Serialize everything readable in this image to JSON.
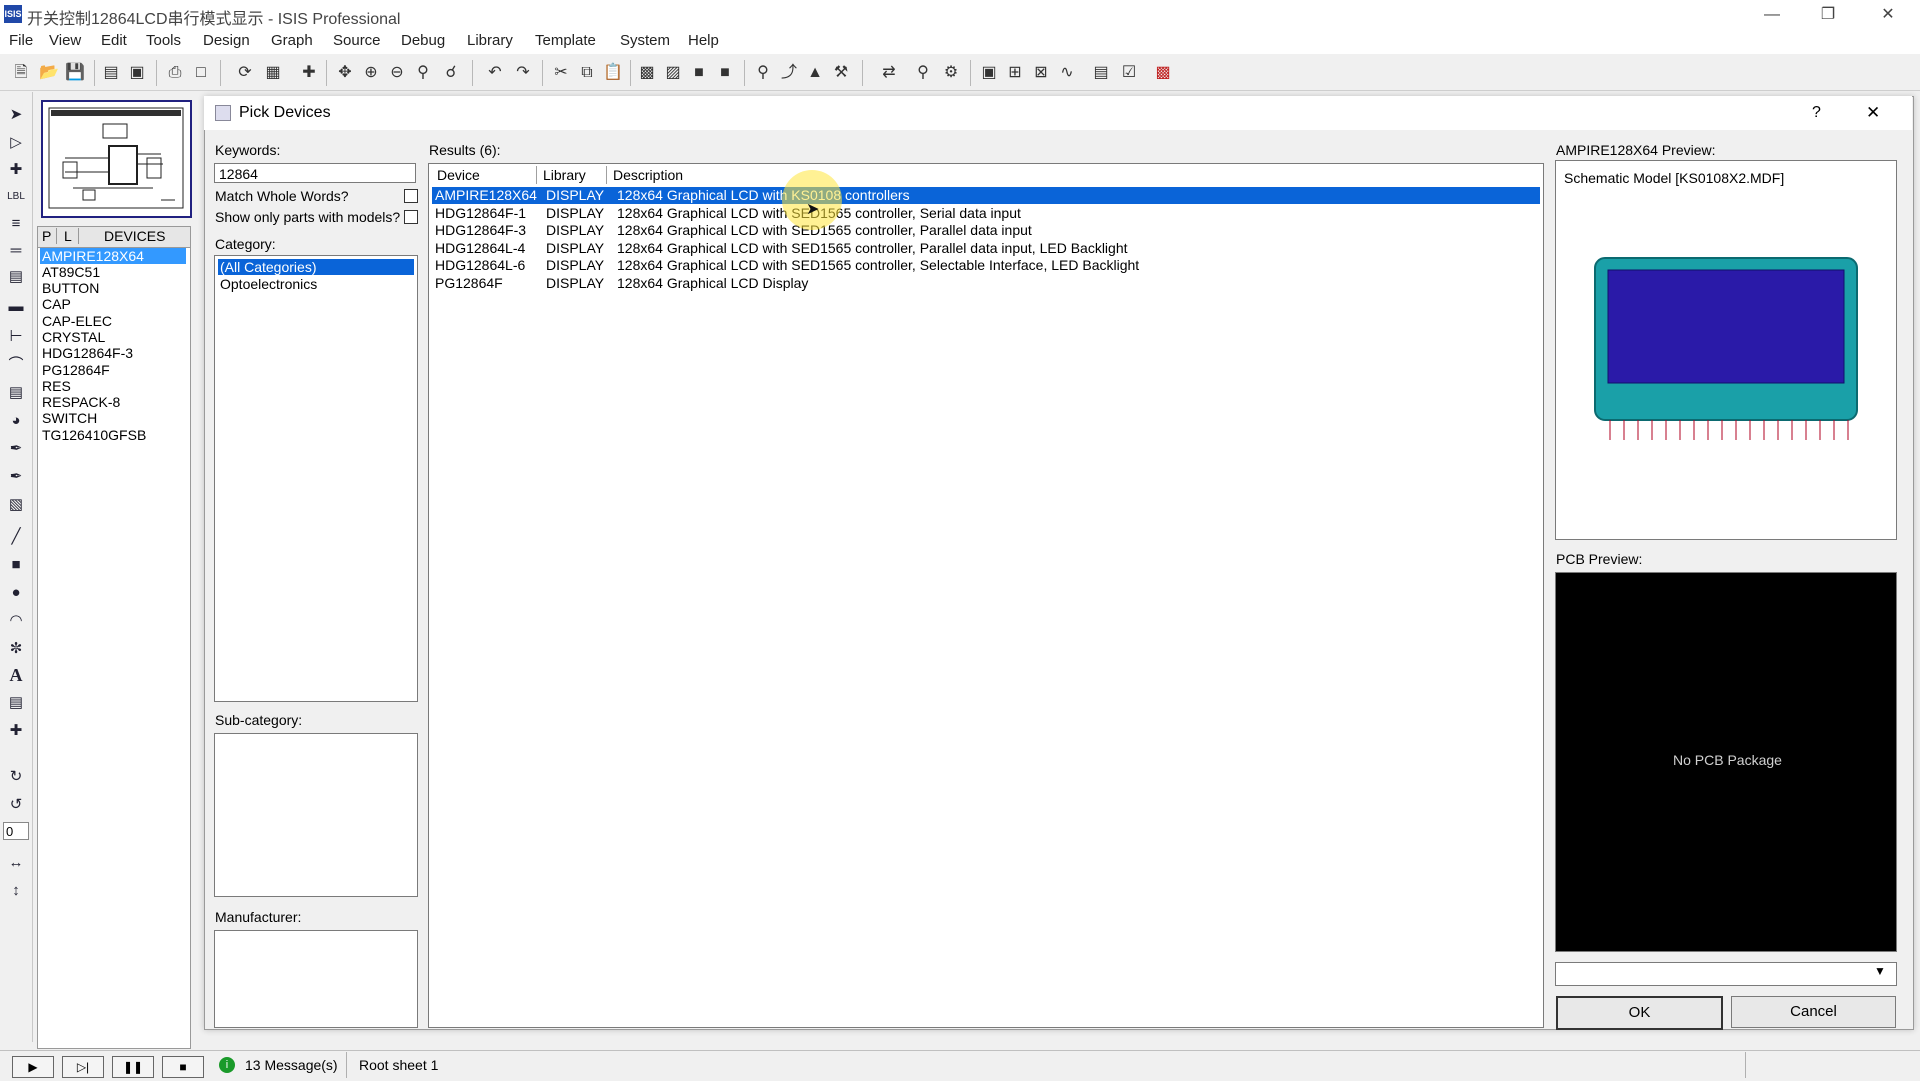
{
  "window": {
    "title": "开关控制12864LCD串行模式显示 - ISIS Professional",
    "app_icon_text": "ISIS"
  },
  "menu": [
    "File",
    "View",
    "Edit",
    "Tools",
    "Design",
    "Graph",
    "Source",
    "Debug",
    "Library",
    "Template",
    "System",
    "Help"
  ],
  "device_panel": {
    "tab_p": "P",
    "tab_l": "L",
    "header": "DEVICES",
    "items": [
      "AMPIRE128X64",
      "AT89C51",
      "BUTTON",
      "CAP",
      "CAP-ELEC",
      "CRYSTAL",
      "HDG12864F-3",
      "PG12864F",
      "RES",
      "RESPACK-8",
      "SWITCH",
      "TG126410GFSB"
    ],
    "selected_index": 0
  },
  "rotation_value": "0",
  "dialog": {
    "title": "Pick Devices",
    "help_label": "?",
    "close_label": "✕",
    "keywords_label": "Keywords:",
    "keywords_value": "12864",
    "match_whole_words_label": "Match Whole Words?",
    "show_only_models_label": "Show only parts with models?",
    "category_label": "Category:",
    "categories": [
      "(All Categories)",
      "Optoelectronics"
    ],
    "subcategory_label": "Sub-category:",
    "manufacturer_label": "Manufacturer:",
    "results_label": "Results (6):",
    "columns": [
      "Device",
      "Library",
      "Description"
    ],
    "results": [
      {
        "device": "AMPIRE128X64",
        "library": "DISPLAY",
        "description": "128x64 Graphical LCD with KS0108 controllers"
      },
      {
        "device": "HDG12864F-1",
        "library": "DISPLAY",
        "description": "128x64 Graphical LCD with SED1565 controller, Serial data input"
      },
      {
        "device": "HDG12864F-3",
        "library": "DISPLAY",
        "description": "128x64 Graphical LCD with SED1565 controller, Parallel data input"
      },
      {
        "device": "HDG12864L-4",
        "library": "DISPLAY",
        "description": "128x64 Graphical LCD with SED1565 controller, Parallel data input, LED Backlight"
      },
      {
        "device": "HDG12864L-6",
        "library": "DISPLAY",
        "description": "128x64 Graphical LCD with SED1565 controller, Selectable Interface, LED Backlight"
      },
      {
        "device": "PG12864F",
        "library": "DISPLAY",
        "description": "128x64 Graphical LCD Display"
      }
    ],
    "selected_result_index": 0,
    "preview_label": "AMPIRE128X64 Preview:",
    "schematic_model": "Schematic Model [KS0108X2.MDF]",
    "pcb_preview_label": "PCB Preview:",
    "no_pcb_text": "No PCB Package",
    "ok_label": "OK",
    "cancel_label": "Cancel"
  },
  "statusbar": {
    "messages": "13 Message(s)",
    "sheet": "Root sheet 1"
  },
  "colors": {
    "selection": "#0a64d8",
    "lcd_body": "#1aa0a8",
    "lcd_screen": "#2a1aa8",
    "pin_color": "#b00020"
  }
}
